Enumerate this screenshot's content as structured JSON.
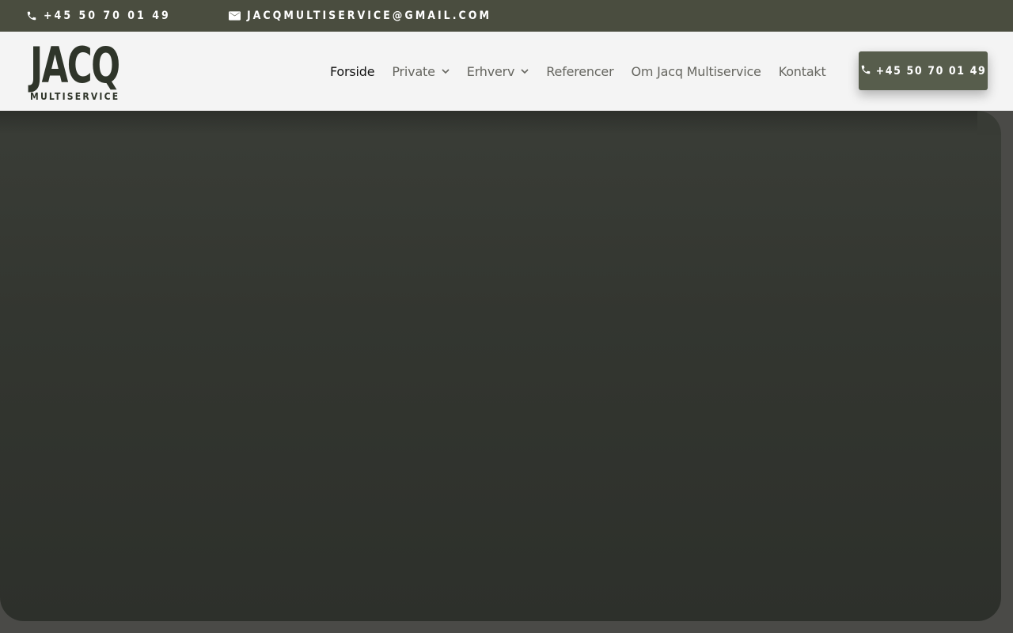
{
  "topbar": {
    "phone": "+45 50 70 01 49",
    "email": "JACQMULTISERVICE@GMAIL.COM",
    "phone_icon": "phone-icon",
    "email_icon": "envelope-icon"
  },
  "logo": {
    "main": "JACQ",
    "sub": "MULTISERVICE"
  },
  "nav": {
    "items": [
      {
        "label": "Forside",
        "active": true
      },
      {
        "label": "Private",
        "dropdown": true
      },
      {
        "label": "Erhverv",
        "dropdown": true
      },
      {
        "label": "Referencer"
      },
      {
        "label": "Om Jacq Multiservice"
      },
      {
        "label": "Kontakt"
      }
    ]
  },
  "cta": {
    "label": "+45 50 70 01 49",
    "icon": "phone-icon"
  },
  "colors": {
    "topbar": "#4a4d3f",
    "header": "#f4f4f4",
    "accent": "#575d4c",
    "logo": "#2f352a",
    "hero": "#333630"
  }
}
